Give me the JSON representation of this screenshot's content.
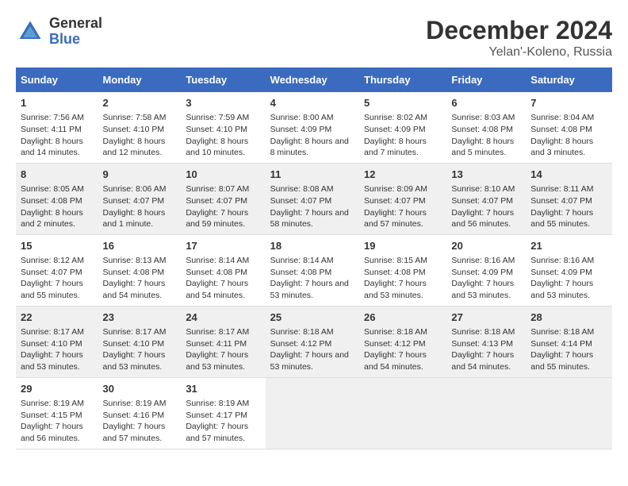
{
  "header": {
    "logo_line1": "General",
    "logo_line2": "Blue",
    "title": "December 2024",
    "subtitle": "Yelan'-Koleno, Russia"
  },
  "weekdays": [
    "Sunday",
    "Monday",
    "Tuesday",
    "Wednesday",
    "Thursday",
    "Friday",
    "Saturday"
  ],
  "weeks": [
    [
      {
        "day": "1",
        "sunrise": "7:56 AM",
        "sunset": "4:11 PM",
        "daylight": "8 hours and 14 minutes."
      },
      {
        "day": "2",
        "sunrise": "7:58 AM",
        "sunset": "4:10 PM",
        "daylight": "8 hours and 12 minutes."
      },
      {
        "day": "3",
        "sunrise": "7:59 AM",
        "sunset": "4:10 PM",
        "daylight": "8 hours and 10 minutes."
      },
      {
        "day": "4",
        "sunrise": "8:00 AM",
        "sunset": "4:09 PM",
        "daylight": "8 hours and 8 minutes."
      },
      {
        "day": "5",
        "sunrise": "8:02 AM",
        "sunset": "4:09 PM",
        "daylight": "8 hours and 7 minutes."
      },
      {
        "day": "6",
        "sunrise": "8:03 AM",
        "sunset": "4:08 PM",
        "daylight": "8 hours and 5 minutes."
      },
      {
        "day": "7",
        "sunrise": "8:04 AM",
        "sunset": "4:08 PM",
        "daylight": "8 hours and 3 minutes."
      }
    ],
    [
      {
        "day": "8",
        "sunrise": "8:05 AM",
        "sunset": "4:08 PM",
        "daylight": "8 hours and 2 minutes."
      },
      {
        "day": "9",
        "sunrise": "8:06 AM",
        "sunset": "4:07 PM",
        "daylight": "8 hours and 1 minute."
      },
      {
        "day": "10",
        "sunrise": "8:07 AM",
        "sunset": "4:07 PM",
        "daylight": "7 hours and 59 minutes."
      },
      {
        "day": "11",
        "sunrise": "8:08 AM",
        "sunset": "4:07 PM",
        "daylight": "7 hours and 58 minutes."
      },
      {
        "day": "12",
        "sunrise": "8:09 AM",
        "sunset": "4:07 PM",
        "daylight": "7 hours and 57 minutes."
      },
      {
        "day": "13",
        "sunrise": "8:10 AM",
        "sunset": "4:07 PM",
        "daylight": "7 hours and 56 minutes."
      },
      {
        "day": "14",
        "sunrise": "8:11 AM",
        "sunset": "4:07 PM",
        "daylight": "7 hours and 55 minutes."
      }
    ],
    [
      {
        "day": "15",
        "sunrise": "8:12 AM",
        "sunset": "4:07 PM",
        "daylight": "7 hours and 55 minutes."
      },
      {
        "day": "16",
        "sunrise": "8:13 AM",
        "sunset": "4:08 PM",
        "daylight": "7 hours and 54 minutes."
      },
      {
        "day": "17",
        "sunrise": "8:14 AM",
        "sunset": "4:08 PM",
        "daylight": "7 hours and 54 minutes."
      },
      {
        "day": "18",
        "sunrise": "8:14 AM",
        "sunset": "4:08 PM",
        "daylight": "7 hours and 53 minutes."
      },
      {
        "day": "19",
        "sunrise": "8:15 AM",
        "sunset": "4:08 PM",
        "daylight": "7 hours and 53 minutes."
      },
      {
        "day": "20",
        "sunrise": "8:16 AM",
        "sunset": "4:09 PM",
        "daylight": "7 hours and 53 minutes."
      },
      {
        "day": "21",
        "sunrise": "8:16 AM",
        "sunset": "4:09 PM",
        "daylight": "7 hours and 53 minutes."
      }
    ],
    [
      {
        "day": "22",
        "sunrise": "8:17 AM",
        "sunset": "4:10 PM",
        "daylight": "7 hours and 53 minutes."
      },
      {
        "day": "23",
        "sunrise": "8:17 AM",
        "sunset": "4:10 PM",
        "daylight": "7 hours and 53 minutes."
      },
      {
        "day": "24",
        "sunrise": "8:17 AM",
        "sunset": "4:11 PM",
        "daylight": "7 hours and 53 minutes."
      },
      {
        "day": "25",
        "sunrise": "8:18 AM",
        "sunset": "4:12 PM",
        "daylight": "7 hours and 53 minutes."
      },
      {
        "day": "26",
        "sunrise": "8:18 AM",
        "sunset": "4:12 PM",
        "daylight": "7 hours and 54 minutes."
      },
      {
        "day": "27",
        "sunrise": "8:18 AM",
        "sunset": "4:13 PM",
        "daylight": "7 hours and 54 minutes."
      },
      {
        "day": "28",
        "sunrise": "8:18 AM",
        "sunset": "4:14 PM",
        "daylight": "7 hours and 55 minutes."
      }
    ],
    [
      {
        "day": "29",
        "sunrise": "8:19 AM",
        "sunset": "4:15 PM",
        "daylight": "7 hours and 56 minutes."
      },
      {
        "day": "30",
        "sunrise": "8:19 AM",
        "sunset": "4:16 PM",
        "daylight": "7 hours and 57 minutes."
      },
      {
        "day": "31",
        "sunrise": "8:19 AM",
        "sunset": "4:17 PM",
        "daylight": "7 hours and 57 minutes."
      },
      null,
      null,
      null,
      null
    ]
  ]
}
